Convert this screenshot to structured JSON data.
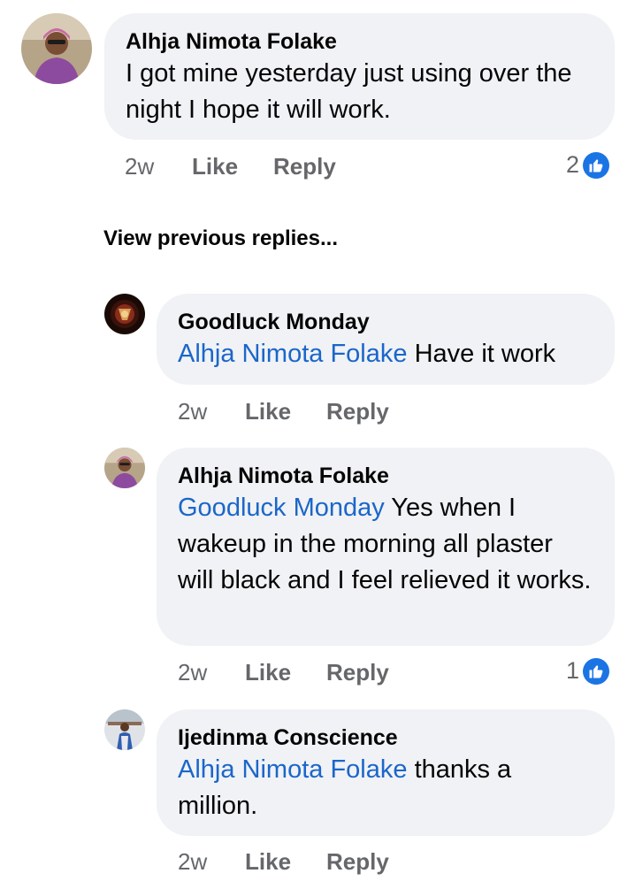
{
  "comment": {
    "author": "Alhja Nimota Folake",
    "text": "I got mine yesterday just using over the night I hope it will work.",
    "time": "2w",
    "like_label": "Like",
    "reply_label": "Reply",
    "reaction_count": "2"
  },
  "view_previous_label": "View previous replies...",
  "replies": [
    {
      "author": "Goodluck Monday",
      "mention": "Alhja Nimota Folake",
      "text": "Have it work",
      "time": "2w",
      "like_label": "Like",
      "reply_label": "Reply"
    },
    {
      "author": "Alhja Nimota Folake",
      "mention": "Goodluck Monday",
      "text": "Yes when I wakeup in the morning all plaster will black and I feel relieved it works.",
      "time": "2w",
      "like_label": "Like",
      "reply_label": "Reply",
      "reaction_count": "1"
    },
    {
      "author": "Ijedinma Conscience",
      "mention": "Alhja Nimota Folake",
      "text": "thanks a million.",
      "time": "2w",
      "like_label": "Like",
      "reply_label": "Reply"
    }
  ],
  "colors": {
    "bubble": "#f0f2f5",
    "mention": "#1b66c9",
    "like_badge": "#1b74e4",
    "meta": "#65676b"
  }
}
